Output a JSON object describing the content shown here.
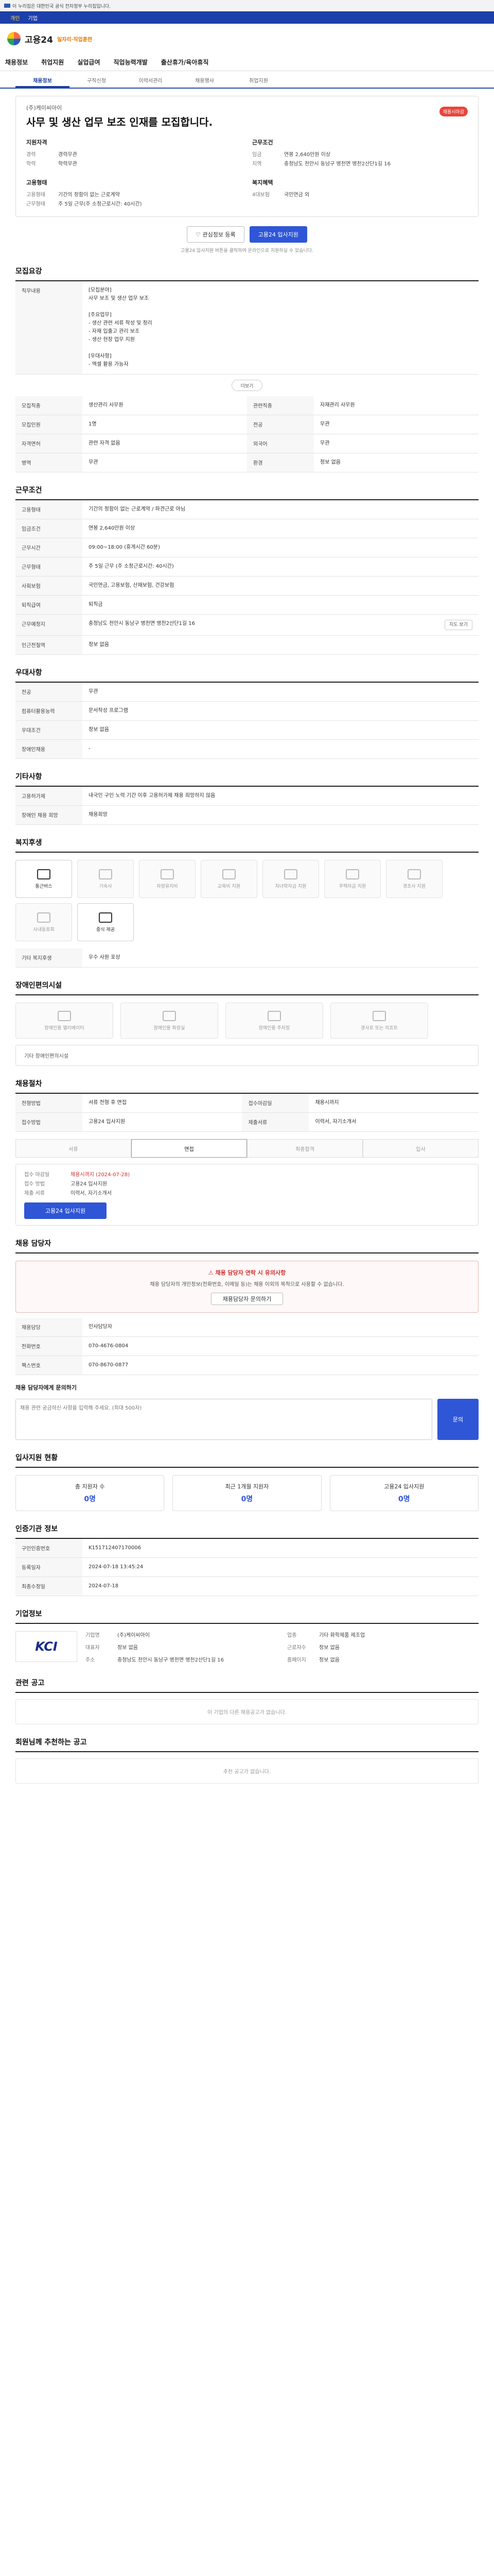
{
  "gov_banner": "이 누리집은 대한민국 공식 전자정부 누리집입니다.",
  "userbar": {
    "items": [
      "개인",
      "기업"
    ]
  },
  "brand": {
    "name": "고용24",
    "sub": "일자리·직업훈련"
  },
  "gnb": [
    "채용정보",
    "취업지원",
    "실업급여",
    "직업능력개발",
    "출산휴가/육아휴직"
  ],
  "subtabs": [
    "채용정보",
    "구직신청",
    "이력서관리",
    "채용행사",
    "취업지원"
  ],
  "header": {
    "company": "(주)케이씨아이",
    "title": "사무 및 생산 업무 보조 인재를 모집합니다.",
    "badge": "채용시마감",
    "qualifications": {
      "title": "지원자격",
      "rows": [
        [
          "경력",
          "경력무관"
        ],
        [
          "학력",
          "학력무관"
        ]
      ]
    },
    "conditions": {
      "title": "근무조건",
      "rows": [
        [
          "임금",
          "연봉 2,640만원 이상"
        ],
        [
          "지역",
          "충청남도 천안시 동남구 병천면 병천2산단1길 16"
        ]
      ]
    },
    "employ": {
      "title": "고용형태",
      "rows": [
        [
          "고용형태",
          "기간의 정함이 없는 근로계약"
        ],
        [
          "근무형태",
          "주 5일 근무(주 소정근로시간: 40시간)"
        ]
      ]
    },
    "welfare": {
      "title": "복지혜택",
      "rows": [
        [
          "4대보험",
          "국민연금 외"
        ]
      ]
    }
  },
  "actions": {
    "favorite": "관심정보 등록",
    "apply": "고용24 입사지원"
  },
  "notice": "고용24 입사지원 버튼을 클릭하여 온라인으로 지원하실 수 있습니다.",
  "job": {
    "section": "모집요강",
    "desc_title": "직무내용",
    "desc": "[모집분야]\n사무 보조 및 생산 업무 보조\n\n[주요업무]\n- 생산 관련 서류 작성 및 정리\n- 자재 입출고 관리 보조\n- 생산 현장 업무 지원\n\n[우대사항]\n- 엑셀 활용 가능자",
    "more": "더보기",
    "rows": [
      [
        "모집직종",
        "생산관리 사무원",
        "관련직종",
        "자재관리 사무원"
      ],
      [
        "모집인원",
        "1명",
        "전공",
        "무관"
      ],
      [
        "자격면허",
        "관련 자격 없음",
        "외국어",
        "무관"
      ],
      [
        "병역",
        "무관",
        "환경",
        "정보 없음"
      ]
    ]
  },
  "cond": {
    "section": "근무조건",
    "rows": [
      [
        "고용형태",
        "기간의 정함이 없는 근로계약 / 파견근로 아님"
      ],
      [
        "임금조건",
        "연봉 2,640만원 이상"
      ],
      [
        "근무시간",
        "09:00~18:00 (휴게시간 60분)"
      ],
      [
        "근무형태",
        "주 5일 근무 (주 소정근로시간: 40시간)"
      ],
      [
        "사회보험",
        "국민연금, 고용보험, 산재보험, 건강보험"
      ],
      [
        "퇴직급여",
        "퇴직금"
      ],
      [
        "근무예정지",
        "충청남도 천안시 동남구 병천면 병천2산단1길 16"
      ],
      [
        "인근전철역",
        "정보 없음"
      ]
    ]
  },
  "prefer": {
    "section": "우대사항",
    "rows": [
      [
        "전공",
        "무관"
      ],
      [
        "컴퓨터활용능력",
        "문서작성 프로그램"
      ],
      [
        "우대조건",
        "정보 없음"
      ],
      [
        "장애인채용",
        "-"
      ]
    ]
  },
  "other": {
    "section": "기타사항",
    "rows": [
      [
        "고용허가제",
        "내국인 구인 노력 기간 이후 고용허가제 채용 희망하지 않음"
      ],
      [
        "장애인 채용 희망",
        "채용희망"
      ]
    ]
  },
  "benefits": {
    "section": "복지후생",
    "items": [
      [
        "통근버스",
        true
      ],
      [
        "기숙사",
        false
      ],
      [
        "차량유지비",
        false
      ],
      [
        "교육비 지원",
        false
      ],
      [
        "자녀학자금 지원",
        false
      ],
      [
        "주택자금 지원",
        false
      ],
      [
        "경조사 지원",
        false
      ],
      [
        "사내동호회",
        false
      ],
      [
        "중식 제공",
        true
      ]
    ],
    "extra": "기타 복지후생",
    "extra_value": "우수 사원 포상"
  },
  "facilities": {
    "section": "장애인편의시설",
    "items": [
      "장애인용 엘리베이터",
      "장애인용 화장실",
      "장애인용 주차장",
      "경사로 또는 리프트"
    ],
    "note": "기타 장애인편의시설"
  },
  "process": {
    "section": "채용절차",
    "rows": [
      [
        "전형방법",
        "서류 전형 후 면접"
      ],
      [
        "접수마감일",
        "채용시까지"
      ],
      [
        "접수방법",
        "고용24 입사지원"
      ],
      [
        "제출서류",
        "이력서, 자기소개서"
      ]
    ],
    "steps": [
      "서류",
      "면접",
      "최종합격",
      "입사"
    ]
  },
  "apply_box": {
    "deadline_label": "접수 마감일",
    "deadline": "채용시까지 (2024-07-28)",
    "method_label": "접수 방법",
    "method": "고용24 입사지원",
    "docs_label": "제출 서류",
    "docs": "이력서, 자기소개서",
    "button": "고용24 입사지원"
  },
  "manager": {
    "section": "채용 담당자",
    "warn": "채용 담당자 연락 시 유의사항",
    "text": "채용 담당자의 개인정보(전화번호, 이메일 등)는 채용 이외의 목적으로 사용할 수 없습니다.",
    "btn": "채용담당자 문의하기",
    "rows": [
      [
        "채용담당",
        "인사담당자"
      ],
      [
        "전화번호",
        "070-4676-0804"
      ],
      [
        "팩스번호",
        "070-8670-0877"
      ]
    ]
  },
  "qa": {
    "title": "채용 담당자에게 문의하기",
    "placeholder": "채용 관련 궁금하신 사항을 입력해 주세요. (최대 500자)",
    "btn": "문의"
  },
  "stats": {
    "section": "입사지원 현황",
    "items": [
      [
        "총 지원자 수",
        "0명"
      ],
      [
        "최근 1개월 지원자",
        "0명"
      ],
      [
        "고용24 입사지원",
        "0명"
      ]
    ]
  },
  "info": {
    "section": "인증기관 정보",
    "rows": [
      [
        "구인인증번호",
        "K151712407170006"
      ],
      [
        "등록일자",
        "2024-07-18 13:45:24"
      ],
      [
        "최종수정일",
        "2024-07-18"
      ]
    ]
  },
  "company_sec": {
    "section": "기업정보",
    "logo": "KCI",
    "rows": [
      [
        "기업명",
        "(주)케이씨아이"
      ],
      [
        "업종",
        "기타 화학제품 제조업"
      ],
      [
        "대표자",
        "정보 없음"
      ],
      [
        "근로자수",
        "정보 없음"
      ],
      [
        "주소",
        "충청남도 천안시 동남구 병천면 병천2산단1길 16"
      ],
      [
        "홈페이지",
        "정보 없음"
      ]
    ]
  },
  "related": {
    "section": "관련 공고",
    "empty": "이 기업의 다른 채용공고가 없습니다."
  },
  "recommend": {
    "section": "회원님께 추천하는 공고",
    "empty": "추천 공고가 없습니다."
  }
}
